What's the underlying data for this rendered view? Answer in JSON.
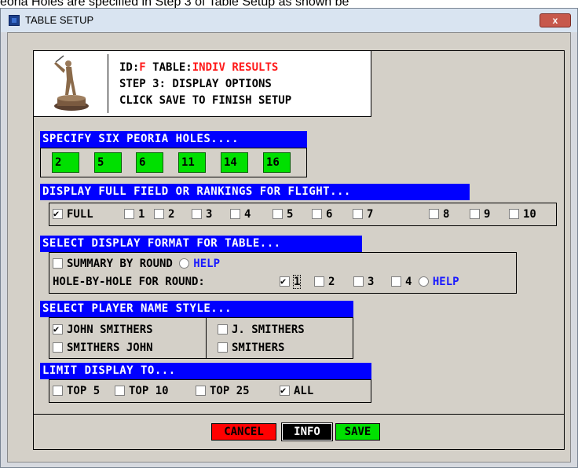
{
  "document_text": "eoria Holes are specified in Step 3 of Table Setup as shown be",
  "window": {
    "title": "TABLE SETUP",
    "close_label": "x"
  },
  "header": {
    "id_label": "ID:",
    "id_value": "F",
    "table_label": " TABLE:",
    "table_value": "INDIV RESULTS",
    "step": "STEP 3: DISPLAY OPTIONS",
    "instruction": "CLICK SAVE TO FINISH SETUP"
  },
  "peoria": {
    "heading": "SPECIFY SIX PEORIA HOLES....",
    "holes": [
      "2",
      "5",
      "6",
      "11",
      "14",
      "16"
    ]
  },
  "field": {
    "heading": "DISPLAY FULL FIELD OR RANKINGS FOR FLIGHT...",
    "options": [
      {
        "label": "FULL",
        "checked": true
      },
      {
        "label": "1"
      },
      {
        "label": "2"
      },
      {
        "label": "3"
      },
      {
        "label": "4"
      },
      {
        "label": "5"
      },
      {
        "label": "6"
      },
      {
        "label": "7"
      },
      {
        "label": "8"
      },
      {
        "label": "9"
      },
      {
        "label": "10"
      }
    ]
  },
  "format": {
    "heading": "SELECT DISPLAY FORMAT FOR TABLE...",
    "summary_label": "SUMMARY BY ROUND",
    "help_label": "HELP",
    "hole_label": "HOLE-BY-HOLE FOR ROUND:",
    "rounds": [
      {
        "label": "1",
        "checked": true
      },
      {
        "label": "2"
      },
      {
        "label": "3"
      },
      {
        "label": "4"
      }
    ],
    "help2_label": "HELP"
  },
  "name_style": {
    "heading": "SELECT PLAYER NAME STYLE...",
    "options": [
      "JOHN SMITHERS",
      "J. SMITHERS",
      "SMITHERS JOHN",
      "SMITHERS"
    ],
    "selected": "JOHN SMITHERS"
  },
  "limit": {
    "heading": "LIMIT DISPLAY TO...",
    "options": [
      {
        "label": "TOP 5"
      },
      {
        "label": "TOP 10"
      },
      {
        "label": "TOP 25"
      },
      {
        "label": "ALL",
        "checked": true
      }
    ]
  },
  "buttons": {
    "cancel": "CANCEL",
    "info": "INFO",
    "save": "SAVE"
  },
  "colors": {
    "section_bar": "#0000ff",
    "hole_box": "#00e000",
    "cancel": "#ff0000",
    "info": "#000000",
    "save": "#00e000",
    "help": "#1a1aff"
  }
}
